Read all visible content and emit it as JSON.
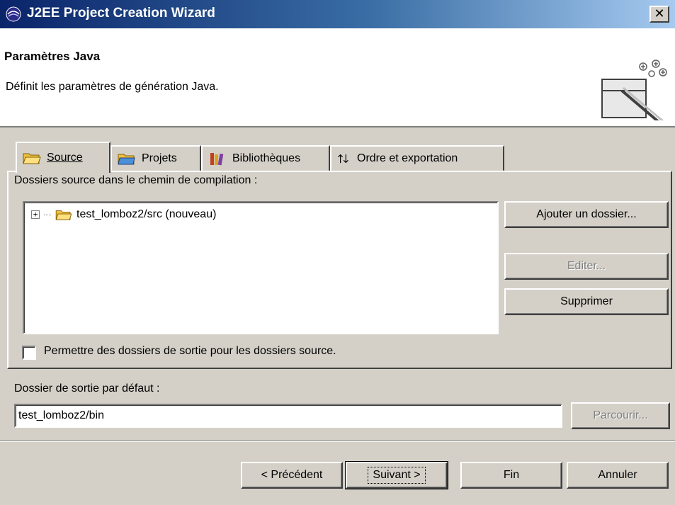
{
  "window": {
    "title": "J2EE Project Creation Wizard",
    "close_label": "✕"
  },
  "banner": {
    "heading": "Paramètres Java",
    "description": "Définit les paramètres de génération Java."
  },
  "tabs": [
    {
      "label": "Source",
      "icon": "folder-open-icon",
      "active": true
    },
    {
      "label": "Projets",
      "icon": "folder-icon",
      "active": false
    },
    {
      "label": "Bibliothèques",
      "icon": "library-books-icon",
      "active": false
    },
    {
      "label": "Ordre et exportation",
      "icon": "sort-arrows-icon",
      "active": false
    }
  ],
  "source_panel": {
    "label": "Dossiers source dans le chemin de compilation :",
    "tree_items": [
      {
        "label": "test_lomboz2/src (nouveau)",
        "expander": "+"
      }
    ],
    "buttons": {
      "add_folder": "Ajouter un dossier...",
      "edit": "Editer...",
      "remove": "Supprimer"
    },
    "allow_output_checkbox": {
      "label": "Permettre des dossiers de sortie pour les dossiers source.",
      "checked": false
    }
  },
  "output": {
    "label": "Dossier de sortie par défaut :",
    "value": "test_lomboz2/bin",
    "browse": "Parcourir..."
  },
  "footer": {
    "back": "< Précédent",
    "next": "Suivant >",
    "finish": "Fin",
    "cancel": "Annuler"
  },
  "colors": {
    "face": "#d4d0c8",
    "title_start": "#0a246a",
    "title_end": "#a6caf0",
    "folder": "#f0c040"
  }
}
